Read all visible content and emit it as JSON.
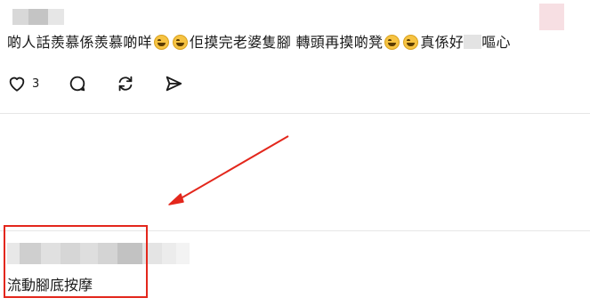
{
  "post": {
    "text_part1": "啲人話羨慕係羨慕啲咩",
    "text_part2": "佢摸完老婆隻腳 轉頭再摸啲凳",
    "text_part3": "真係好",
    "text_part4": "嘔心",
    "emoji_name": "grinning-squinting-face",
    "like_count": "3"
  },
  "reply": {
    "text": "流動腳底按摩"
  },
  "colors": {
    "highlight": "#e3271c",
    "arrow": "#e3271c",
    "divider": "#e6e6e6"
  }
}
